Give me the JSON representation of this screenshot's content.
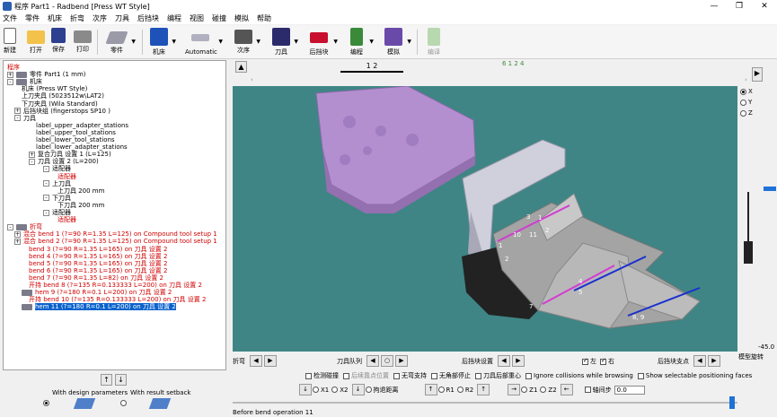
{
  "window": {
    "title": "程序 Part1 - Radbend [Press WT Style]",
    "minimize": "—",
    "restore": "❐",
    "close": "✕"
  },
  "menu": [
    "文件",
    "零件",
    "机床",
    "折弯",
    "次序",
    "刀具",
    "后挡块",
    "编程",
    "视图",
    "碰撞",
    "模拟",
    "帮助"
  ],
  "toolbar": {
    "new": "新建",
    "open": "打开",
    "save": "保存",
    "print": "打印",
    "part": "零件",
    "machine": "机床",
    "automatic": "Automatic",
    "sequence": "次序",
    "tools": "刀具",
    "backgauge": "后挡块",
    "program": "编程",
    "simulate": "模拟",
    "translate": "编译"
  },
  "tree": [
    {
      "text": "程序",
      "indent": 0,
      "exp": "",
      "color": "red",
      "icon": false
    },
    {
      "text": "零件 Part1 (1 mm)",
      "indent": 0,
      "exp": "+",
      "color": "",
      "icon": true
    },
    {
      "text": "机床",
      "indent": 0,
      "exp": "-",
      "color": "",
      "icon": true
    },
    {
      "text": "机床 (Press WT Style)",
      "indent": 2,
      "exp": "",
      "color": "",
      "icon": false
    },
    {
      "text": "上刀夹具 (5023512w\\LAT2)",
      "indent": 2,
      "exp": "",
      "color": "",
      "icon": false
    },
    {
      "text": "下刀夹具 (Wila Standard)",
      "indent": 2,
      "exp": "",
      "color": "",
      "icon": false
    },
    {
      "text": "后挡块组 (fingerstops SP10 )",
      "indent": 1,
      "exp": "+",
      "color": "",
      "icon": false
    },
    {
      "text": "刀具",
      "indent": 1,
      "exp": "-",
      "color": "",
      "icon": false
    },
    {
      "text": "label_upper_adapter_stations",
      "indent": 4,
      "exp": "",
      "color": "",
      "icon": false
    },
    {
      "text": "label_upper_tool_stations",
      "indent": 4,
      "exp": "",
      "color": "",
      "icon": false
    },
    {
      "text": "label_lower_tool_stations",
      "indent": 4,
      "exp": "",
      "color": "",
      "icon": false
    },
    {
      "text": "label_lower_adapter_stations",
      "indent": 4,
      "exp": "",
      "color": "",
      "icon": false
    },
    {
      "text": "复合刀具 设置 1 (L=125)",
      "indent": 3,
      "exp": "+",
      "color": "",
      "icon": false
    },
    {
      "text": "刀具 设置 2 (L=200)",
      "indent": 3,
      "exp": "-",
      "color": "",
      "icon": false
    },
    {
      "text": "适配器",
      "indent": 5,
      "exp": "-",
      "color": "",
      "icon": false
    },
    {
      "text": "适配器",
      "indent": 7,
      "exp": "",
      "color": "red",
      "icon": false
    },
    {
      "text": "上刀具",
      "indent": 5,
      "exp": "-",
      "color": "",
      "icon": false
    },
    {
      "text": "上刀具 200 mm",
      "indent": 7,
      "exp": "",
      "color": "",
      "icon": false
    },
    {
      "text": "下刀具",
      "indent": 5,
      "exp": "-",
      "color": "",
      "icon": false
    },
    {
      "text": "下刀具 200 mm",
      "indent": 7,
      "exp": "",
      "color": "",
      "icon": false
    },
    {
      "text": "适配器",
      "indent": 5,
      "exp": "-",
      "color": "",
      "icon": false
    },
    {
      "text": "适配器",
      "indent": 7,
      "exp": "",
      "color": "red",
      "icon": false
    },
    {
      "text": "折弯",
      "indent": 0,
      "exp": "-",
      "color": "red",
      "icon": true
    },
    {
      "text": "混合 bend 1 (?=90 R=1.35 L=125) on Compound tool setup 1",
      "indent": 1,
      "exp": "+",
      "color": "red",
      "icon": false
    },
    {
      "text": "混合 bend 2 (?=90 R=1.35 L=125) on Compound tool setup 1",
      "indent": 1,
      "exp": "+",
      "color": "red",
      "icon": false
    },
    {
      "text": "bend 3 (?=90 R=1.35 L=165) on 刀具 设置 2",
      "indent": 3,
      "exp": "",
      "color": "red",
      "icon": false
    },
    {
      "text": "bend 4 (?=90 R=1.35 L=165) on 刀具 设置 2",
      "indent": 3,
      "exp": "",
      "color": "red",
      "icon": false
    },
    {
      "text": "bend 5 (?=90 R=1.35 L=165) on 刀具 设置 2",
      "indent": 3,
      "exp": "",
      "color": "red",
      "icon": false
    },
    {
      "text": "bend 6 (?=90 R=1.35 L=165) on 刀具 设置 2",
      "indent": 3,
      "exp": "",
      "color": "red",
      "icon": false
    },
    {
      "text": "bend 7 (?=90 R=1.35 L=82) on 刀具 设置 2",
      "indent": 3,
      "exp": "",
      "color": "red",
      "icon": false
    },
    {
      "text": "开持 bend 8 (?=135 R=0.133333 L=200) on 刀具 设置 2",
      "indent": 3,
      "exp": "",
      "color": "red",
      "icon": false
    },
    {
      "text": "hem 9 (?=180 R=0.1 L=200) on 刀具 设置 2",
      "indent": 2,
      "exp": "",
      "color": "red",
      "icon": true
    },
    {
      "text": "开持 bend 10 (?=135 R=0.133333 L=200) on 刀具 设置 2",
      "indent": 3,
      "exp": "",
      "color": "red",
      "icon": false
    },
    {
      "text": "hem 11 (?=180 R=0.1 L=200) on 刀具 设置 2",
      "indent": 2,
      "exp": "",
      "color": "sel",
      "icon": true
    }
  ],
  "top_strip": {
    "tab_label": "1 2",
    "ruler": "6 1 2 4"
  },
  "viewport_labels": [
    {
      "text": "3"
    },
    {
      "text": "1"
    },
    {
      "text": "10"
    },
    {
      "text": "11"
    },
    {
      "text": "2"
    },
    {
      "text": "1"
    },
    {
      "text": "2"
    },
    {
      "text": "4"
    },
    {
      "text": "5"
    },
    {
      "text": "7"
    },
    {
      "text": "8, 9"
    }
  ],
  "axes": {
    "x": "X",
    "y": "Y",
    "z": "Z",
    "selected": "X"
  },
  "side": {
    "angle": "-45.0",
    "rotate": "模型旋转"
  },
  "controls": {
    "bend": "折弯",
    "tool_queue": "刀具队列",
    "backgauge_set": "后挡块设置",
    "left": "左",
    "right": "右",
    "backgauge_point": "后挡块支点",
    "check_collision": "检测碰撞",
    "gauge_pos": "后续靠点位置",
    "no_support": "无弯支持",
    "no_stop": "无角部停止",
    "tool_center": "刀具后部重心",
    "ignore_collisions": "Ignore collisions while browsing",
    "show_positions": "Show selectable positioning faces",
    "x1": "X1",
    "x2": "X2",
    "retract": "拘退距离",
    "r1": "R1",
    "r2": "R2",
    "z1": "Z1",
    "z2": "Z2",
    "axis_step": "轴间步",
    "axis_value": "0.0"
  },
  "bottom_left": {
    "with_design": "With design parameters",
    "with_result": "With result setback"
  },
  "status": "Before bend operation 11"
}
